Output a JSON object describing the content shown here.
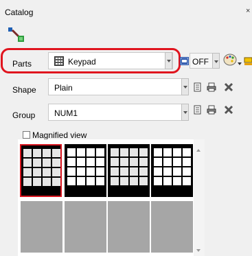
{
  "panel": {
    "title": "Catalog",
    "close_label": "×"
  },
  "parts": {
    "label": "Parts",
    "value": "Keypad",
    "off_label": "OFF"
  },
  "shape": {
    "label": "Shape",
    "value": "Plain"
  },
  "group": {
    "label": "Group",
    "value": "NUM1"
  },
  "magnified_view": {
    "label": "Magnified view",
    "checked": false
  },
  "thumbnails": [
    {
      "style": "plain",
      "selected": true
    },
    {
      "style": "numeric",
      "selected": false
    },
    {
      "style": "plain",
      "selected": false
    },
    {
      "style": "numeric",
      "selected": false
    }
  ],
  "colors": {
    "highlight": "#e0141e",
    "selection": "#d8141e"
  }
}
